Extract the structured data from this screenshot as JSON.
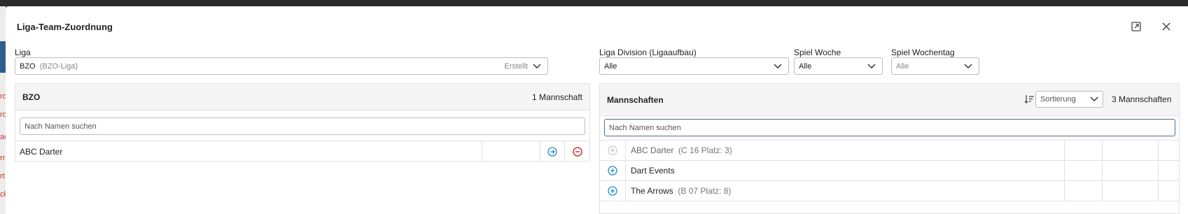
{
  "dialog": {
    "title": "Liga-Team-Zuordnung",
    "expand_icon": "expand-icon",
    "close_icon": "close-icon"
  },
  "filters": {
    "liga": {
      "label": "Liga",
      "value": "BZO",
      "value_detail": "(BZO-Liga)",
      "status": "Erstellt"
    },
    "division": {
      "label": "Liga Division (Ligaaufbau)",
      "value": "Alle"
    },
    "spielwoche": {
      "label": "Spiel Woche",
      "value": "Alle"
    },
    "wochentag": {
      "label": "Spiel Wochentag",
      "placeholder": "Alle"
    }
  },
  "left_panel": {
    "title": "BZO",
    "count": "1 Mannschaft",
    "search_placeholder": "Nach Namen suchen",
    "rows": [
      {
        "name": "ABC Darter",
        "actions": [
          "arrow-right-circle-icon",
          "minus-circle-icon"
        ]
      }
    ]
  },
  "right_panel": {
    "title": "Mannschaften",
    "sort_icon": "sort-icon",
    "sort_placeholder": "Sortierung",
    "count": "3 Mannschaften",
    "search_placeholder": "Nach Namen suchen",
    "rows": [
      {
        "name": "ABC Darter",
        "detail": "(C 16 Platz: 3)",
        "disabled": true
      },
      {
        "name": "Dart Events",
        "detail": "",
        "disabled": false
      },
      {
        "name": "The Arrows",
        "detail": "(B 07 Platz: 8)",
        "disabled": false
      }
    ]
  },
  "colors": {
    "accent": "#1f8fc8",
    "danger": "#d62b2b",
    "header_bg": "#f5f5f5",
    "border": "#e2e2e2"
  }
}
